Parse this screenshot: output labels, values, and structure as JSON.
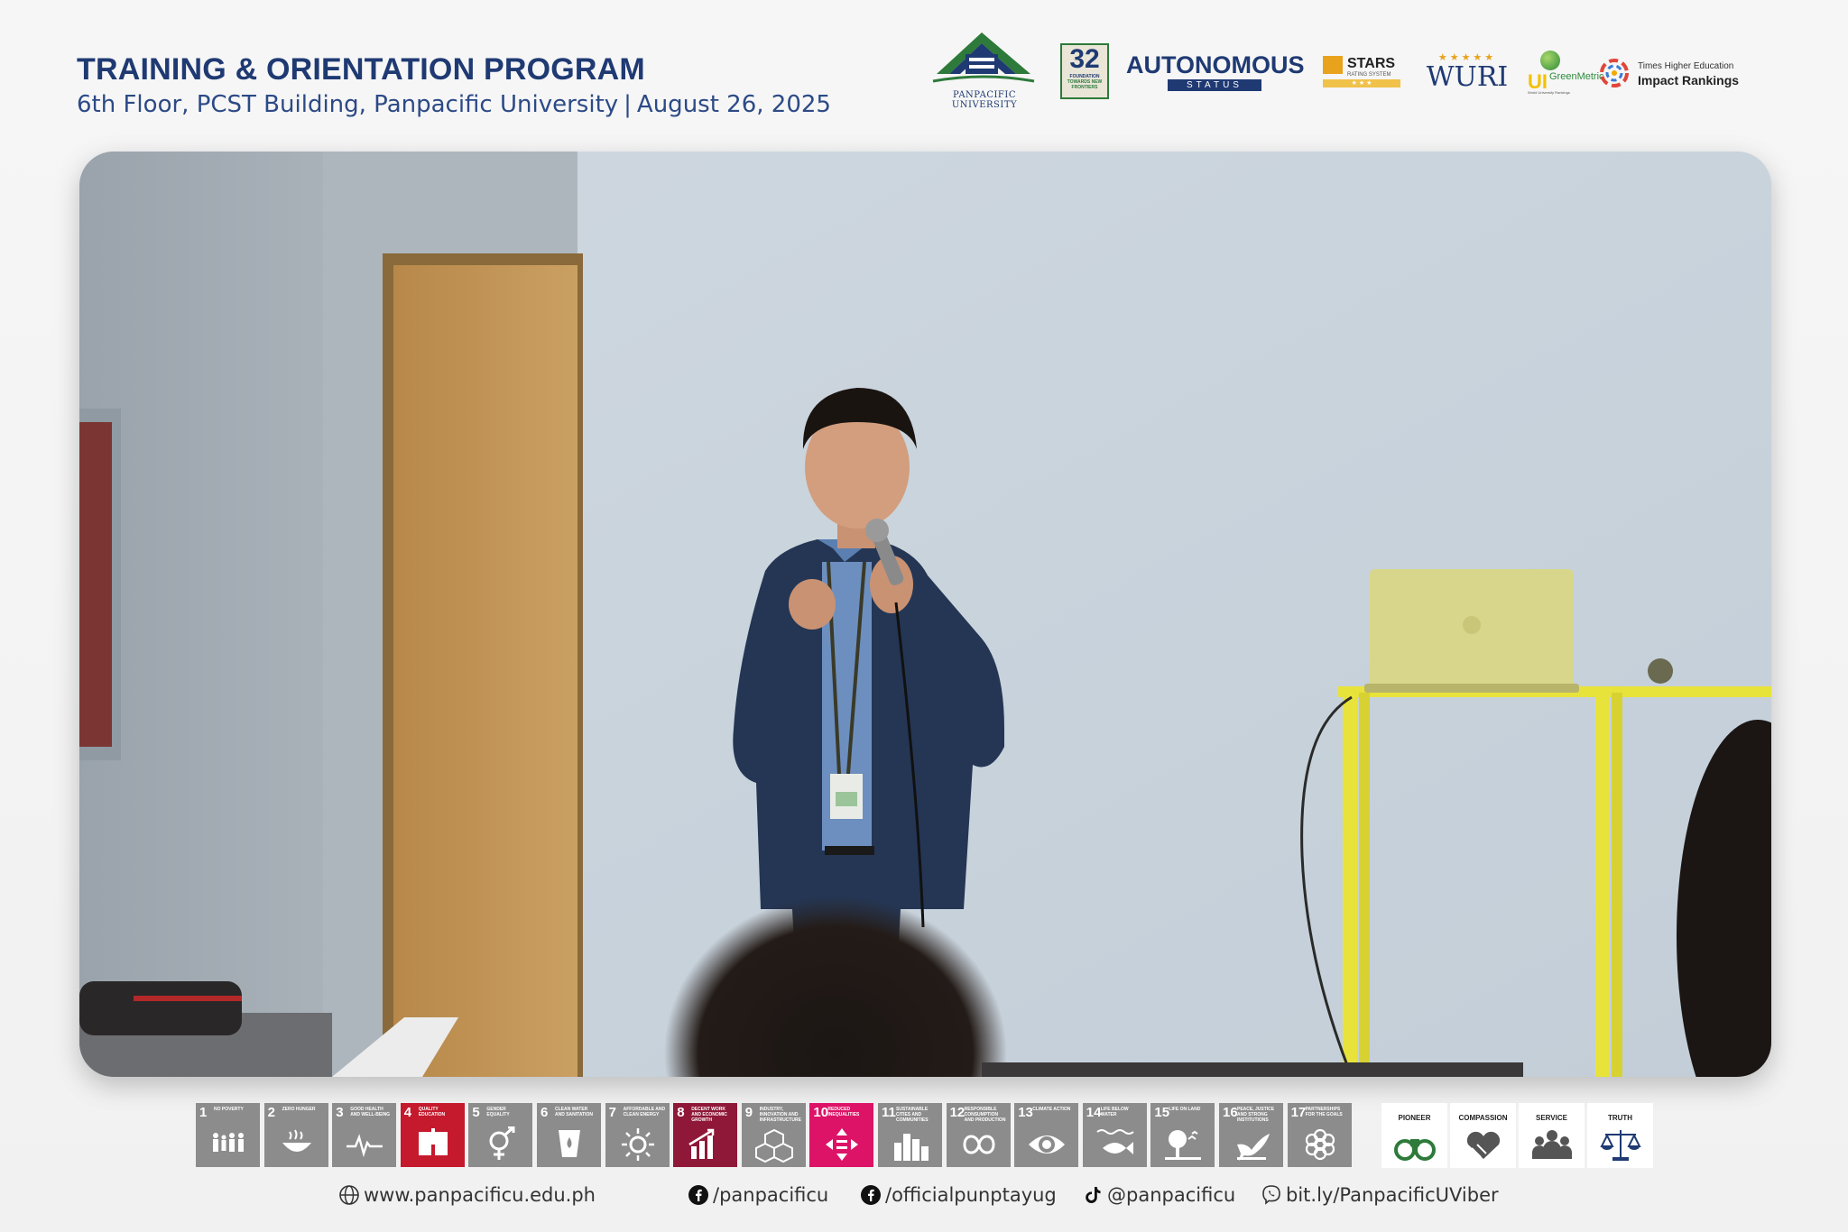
{
  "header": {
    "title": "TRAINING & ORIENTATION PROGRAM",
    "venue": "6th Floor, PCST Building, Panpacific University",
    "separator": "|",
    "date": "August 26, 2025"
  },
  "logos": {
    "university": "PANPACIFIC UNIVERSITY",
    "anniversary_number": "32",
    "anniversary_line1": "FOUNDATION",
    "anniversary_line2": "TOWARDS NEW FRONTIERS",
    "autonomous": "AUTONOMOUS",
    "status": "STATUS",
    "qs_stars": "STARS",
    "qs_stars_sub": "RATING SYSTEM",
    "wuri": "WURI",
    "greenmetric_ui": "UI",
    "greenmetric": "GreenMetric",
    "greenmetric_sub": "World University Rankings",
    "the_line1": "Times Higher Education",
    "the_line2": "Impact Rankings"
  },
  "sdgs": [
    {
      "num": "1",
      "text": "NO POVERTY",
      "color": "#8c8c8c",
      "icon": "family-icon"
    },
    {
      "num": "2",
      "text": "ZERO HUNGER",
      "color": "#8c8c8c",
      "icon": "bowl-icon"
    },
    {
      "num": "3",
      "text": "GOOD HEALTH AND WELL-BEING",
      "color": "#8c8c8c",
      "icon": "heartbeat-icon"
    },
    {
      "num": "4",
      "text": "QUALITY EDUCATION",
      "color": "#c5192d",
      "icon": "book-icon"
    },
    {
      "num": "5",
      "text": "GENDER EQUALITY",
      "color": "#8c8c8c",
      "icon": "gender-icon"
    },
    {
      "num": "6",
      "text": "CLEAN WATER AND SANITATION",
      "color": "#8c8c8c",
      "icon": "water-icon"
    },
    {
      "num": "7",
      "text": "AFFORDABLE AND CLEAN ENERGY",
      "color": "#8c8c8c",
      "icon": "sun-icon"
    },
    {
      "num": "8",
      "text": "DECENT WORK AND ECONOMIC GROWTH",
      "color": "#8f1838",
      "icon": "growth-chart-icon"
    },
    {
      "num": "9",
      "text": "INDUSTRY, INNOVATION AND INFRASTRUCTURE",
      "color": "#8c8c8c",
      "icon": "cubes-icon"
    },
    {
      "num": "10",
      "text": "REDUCED INEQUALITIES",
      "color": "#dd1367",
      "icon": "arrows-equal-icon"
    },
    {
      "num": "11",
      "text": "SUSTAINABLE CITIES AND COMMUNITIES",
      "color": "#8c8c8c",
      "icon": "city-icon"
    },
    {
      "num": "12",
      "text": "RESPONSIBLE CONSUMPTION AND PRODUCTION",
      "color": "#8c8c8c",
      "icon": "infinity-icon"
    },
    {
      "num": "13",
      "text": "CLIMATE ACTION",
      "color": "#8c8c8c",
      "icon": "eye-globe-icon"
    },
    {
      "num": "14",
      "text": "LIFE BELOW WATER",
      "color": "#8c8c8c",
      "icon": "fish-icon"
    },
    {
      "num": "15",
      "text": "LIFE ON LAND",
      "color": "#8c8c8c",
      "icon": "tree-icon"
    },
    {
      "num": "16",
      "text": "PEACE, JUSTICE AND STRONG INSTITUTIONS",
      "color": "#8c8c8c",
      "icon": "dove-icon"
    },
    {
      "num": "17",
      "text": "PARTNERSHIPS FOR THE GOALS",
      "color": "#8c8c8c",
      "icon": "flower-icon"
    }
  ],
  "values": [
    {
      "label": "PIONEER",
      "icon": "binoculars-icon"
    },
    {
      "label": "COMPASSION",
      "icon": "heart-hands-icon"
    },
    {
      "label": "SERVICE",
      "icon": "people-icon"
    },
    {
      "label": "TRUTH",
      "icon": "scales-icon"
    }
  ],
  "footer": {
    "website": "www.panpacificu.edu.ph",
    "facebook1": "/panpacificu",
    "facebook2": "/officialpunptayug",
    "tiktok": "@panpacificu",
    "viber": "bit.ly/PanpacificUViber"
  }
}
